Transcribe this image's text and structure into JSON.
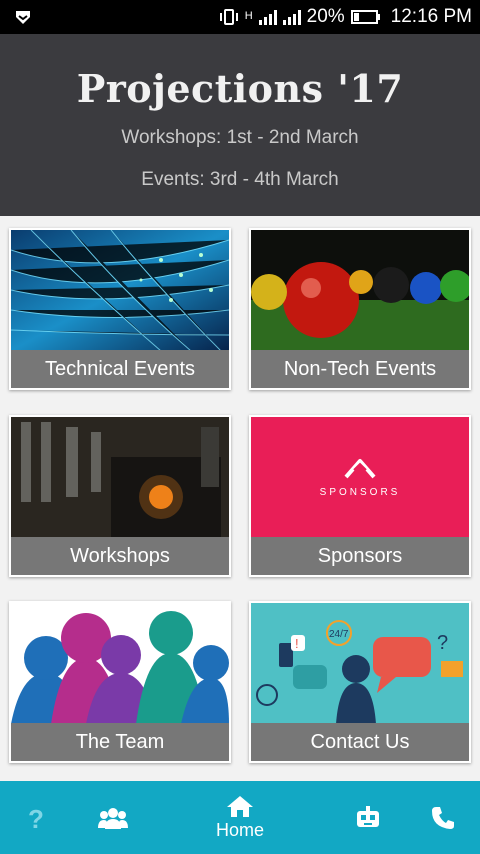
{
  "status_bar": {
    "battery": "20%",
    "time": "12:16 PM",
    "network_indicator": "H"
  },
  "header": {
    "title": "Projections '17",
    "workshops_line": "Workshops: 1st - 2nd March",
    "events_line": "Events: 3rd - 4th March"
  },
  "tiles": [
    {
      "label": "Technical Events"
    },
    {
      "label": "Non-Tech Events"
    },
    {
      "label": "Workshops"
    },
    {
      "label": "Sponsors",
      "image_text": "SPONSORS"
    },
    {
      "label": "The Team"
    },
    {
      "label": "Contact Us",
      "image_text": "24/7"
    }
  ],
  "bottom_nav": {
    "items": [
      {
        "icon": "question-icon"
      },
      {
        "icon": "group-icon"
      },
      {
        "icon": "home-icon",
        "label": "Home"
      },
      {
        "icon": "bot-icon"
      },
      {
        "icon": "phone-icon"
      }
    ]
  },
  "colors": {
    "header_bg": "#3b3b3f",
    "nav_bg": "#12a8c4",
    "label_bg": "#777777",
    "sponsors_bg": "#e91e57"
  }
}
